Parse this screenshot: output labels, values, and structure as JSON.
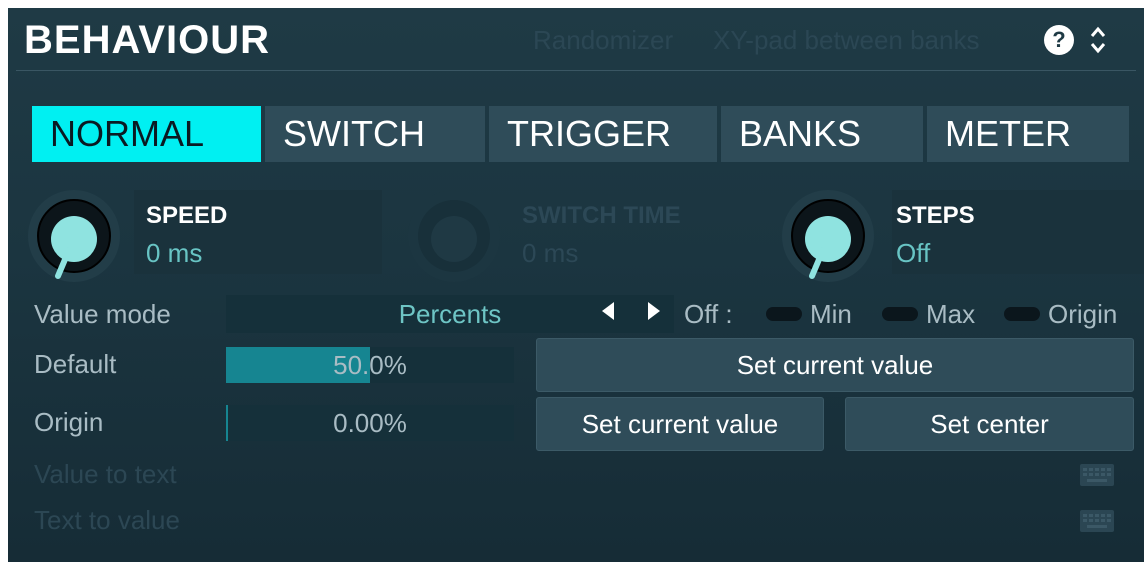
{
  "header": {
    "title": "BEHAVIOUR",
    "links": [
      "Randomizer",
      "XY-pad between banks"
    ],
    "help_icon_text": "?",
    "collapse_icon": "chevron-up-down-icon"
  },
  "tabs": [
    {
      "label": "NORMAL",
      "active": true
    },
    {
      "label": "SWITCH",
      "active": false
    },
    {
      "label": "TRIGGER",
      "active": false
    },
    {
      "label": "BANKS",
      "active": false
    },
    {
      "label": "METER",
      "active": false
    }
  ],
  "knobs": [
    {
      "name": "SPEED",
      "value": "0 ms",
      "level": 0.0,
      "enabled": true
    },
    {
      "name": "SWITCH TIME",
      "value": "0 ms",
      "level": 0.0,
      "enabled": false
    },
    {
      "name": "STEPS",
      "value": "Off",
      "level": 0.0,
      "enabled": true
    }
  ],
  "value_mode": {
    "label": "Value mode",
    "selected": "Percents",
    "off_label": "Off :",
    "options": [
      "Min",
      "Max",
      "Origin"
    ]
  },
  "default": {
    "label": "Default",
    "value_text": "50.0%",
    "fill_fraction": 0.5,
    "button": "Set current value"
  },
  "origin": {
    "label": "Origin",
    "value_text": "0.00%",
    "fill_fraction": 0.0,
    "buttons": [
      "Set current value",
      "Set center"
    ]
  },
  "value_to_text": {
    "label": "Value to text",
    "icon": "keyboard-icon"
  },
  "text_to_value": {
    "label": "Text to value",
    "icon": "keyboard-icon"
  },
  "colors": {
    "accent": "#00f0f2",
    "knob_indicator": "#8fe3e0",
    "value_text": "#68c4c4"
  }
}
